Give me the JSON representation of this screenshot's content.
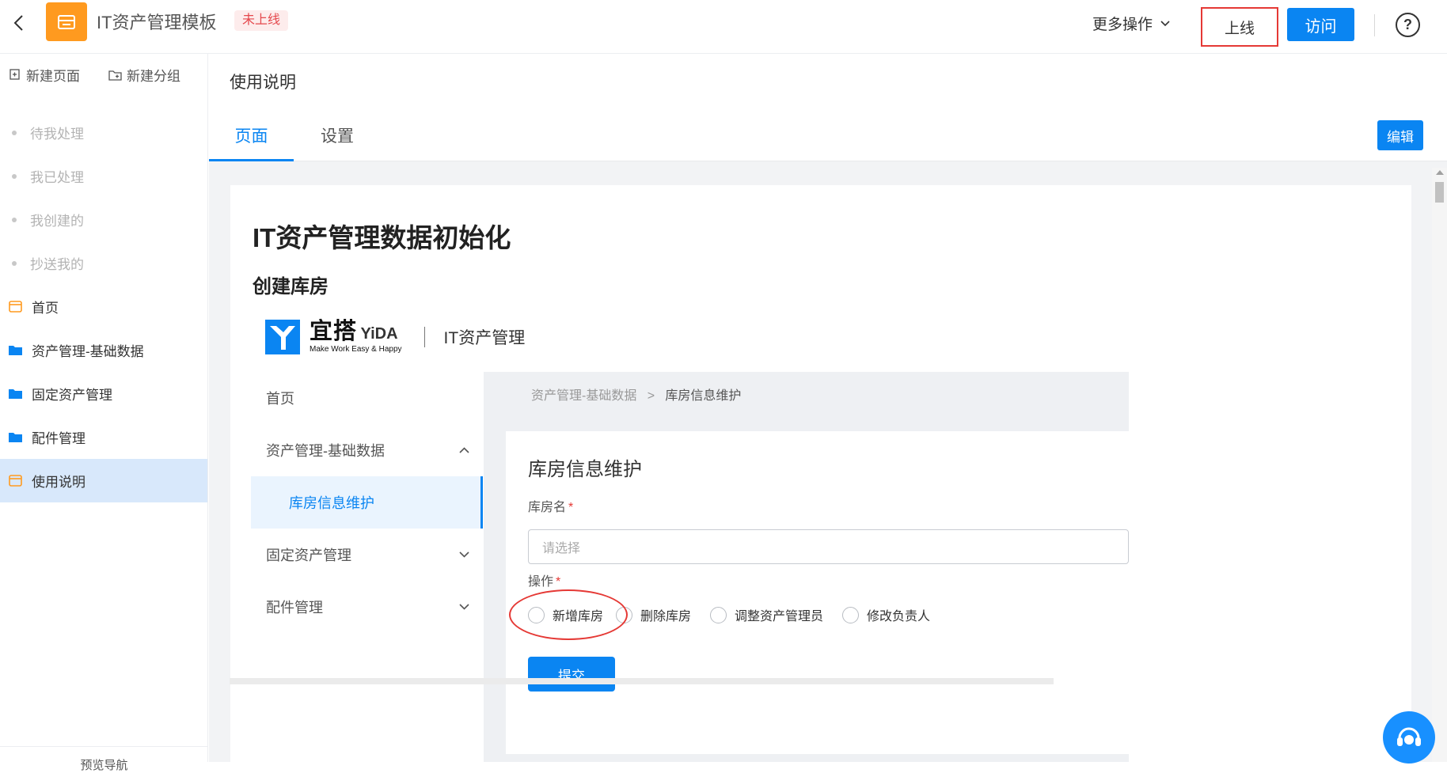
{
  "topbar": {
    "app_title": "IT资产管理模板",
    "status_badge": "未上线",
    "more_ops": "更多操作",
    "online_button": "上线",
    "visit_button": "访问",
    "help": "?"
  },
  "sidebar": {
    "new_page": "新建页面",
    "new_group": "新建分组",
    "items": [
      {
        "label": "待我处理"
      },
      {
        "label": "我已处理"
      },
      {
        "label": "我创建的"
      },
      {
        "label": "抄送我的"
      },
      {
        "label": "首页"
      },
      {
        "label": "资产管理-基础数据"
      },
      {
        "label": "固定资产管理"
      },
      {
        "label": "配件管理"
      },
      {
        "label": "使用说明"
      }
    ],
    "footer": "预览导航"
  },
  "main": {
    "page_title": "使用说明",
    "tabs": [
      {
        "label": "页面"
      },
      {
        "label": "设置"
      }
    ],
    "edit_button": "编辑",
    "heading": "IT资产管理数据初始化",
    "subheading": "创建库房"
  },
  "embedded": {
    "logo_cn": "宜搭",
    "logo_en": "YiDA",
    "logo_slogan": "Make Work Easy & Happy",
    "app_name": "IT资产管理",
    "nav": [
      {
        "label": "首页"
      },
      {
        "label": "资产管理-基础数据"
      },
      {
        "label": "库房信息维护"
      },
      {
        "label": "固定资产管理"
      },
      {
        "label": "配件管理"
      }
    ],
    "breadcrumb": {
      "parent": "资产管理-基础数据",
      "sep": ">",
      "current": "库房信息维护"
    },
    "form_title": "库房信息维护",
    "warehouse_label": "库房名",
    "warehouse_placeholder": "请选择",
    "op_label": "操作",
    "required_mark": "*",
    "options": [
      {
        "label": "新增库房"
      },
      {
        "label": "删除库房"
      },
      {
        "label": "调整资产管理员"
      },
      {
        "label": "修改负责人"
      }
    ],
    "submit": "提交"
  },
  "colors": {
    "accent": "#0a85f2",
    "warning": "#e53935",
    "app_icon": "#ff9a1f"
  }
}
